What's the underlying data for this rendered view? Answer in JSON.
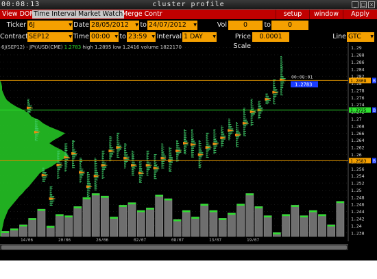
{
  "titlebar": {
    "clock": "00:08:13",
    "title": "cluster profile",
    "btn_min": "_",
    "btn_max": "□",
    "btn_close": "×"
  },
  "menu": {
    "items": [
      "View DOM",
      "Time Interval",
      "Market Watch",
      "Merge Contr"
    ],
    "active": [
      false,
      true,
      true,
      false
    ],
    "right": [
      "setup",
      "window",
      "Apply"
    ]
  },
  "row1": {
    "ticker_label": "Ticker",
    "ticker": "6J",
    "date_label": "Date",
    "date_from": "28/05/2012",
    "to_label": "to",
    "date_to": "24/07/2012",
    "vol_label": "Vol range",
    "vol_from": "0",
    "vol_to_label": "to",
    "vol_to": "0"
  },
  "row2": {
    "contract_label": "Contract",
    "contract": "SEP12",
    "time_label": "Time",
    "time_from": "00:00",
    "to_label": "to",
    "time_to": "23:59",
    "interval_label": "Interval",
    "interval": "1 DAY",
    "scale_label": "Price Scale",
    "scale": "0.0001",
    "line_label": "Line",
    "line": "GTC"
  },
  "chart_header": {
    "symbol": "6J(SEP12) - JPY/USD(CME)",
    "last": "1.2783",
    "high": "high 1.2895",
    "low": "low 1.2416",
    "volume": "volume 1822170"
  },
  "chart_data": {
    "type": "cluster-profile",
    "price_axis": [
      "1.29",
      "1.288",
      "1.286",
      "1.284",
      "1.282",
      "1.28",
      "1.278",
      "1.276",
      "1.274",
      "1.272",
      "1.27",
      "1.268",
      "1.266",
      "1.264",
      "1.262",
      "1.26",
      "1.258",
      "1.256",
      "1.254",
      "1.252",
      "1.25",
      "1.248",
      "1.246",
      "1.244",
      "1.242",
      "1.24",
      "1.238"
    ],
    "ylim": [
      1.237,
      1.2905
    ],
    "date_labels": [
      "14/06",
      "20/06",
      "26/06",
      "02/07",
      "08/07",
      "13/07",
      "19/07"
    ],
    "price_badges": {
      "upper": "1.2808",
      "current": "1.2725",
      "lower": "1.2583"
    },
    "timer": "00:08:01",
    "last_price": "1.2783",
    "side_markers": [
      "B",
      "B",
      "B"
    ],
    "horizontal_lines": [
      1.2808,
      1.2725,
      1.2583
    ],
    "candles": [
      {
        "lo": 1.2716,
        "hi": 1.2755,
        "poc": 1.2731
      },
      {
        "lo": 1.2638,
        "hi": 1.2698,
        "poc": 1.2663
      },
      {
        "lo": 1.2522,
        "hi": 1.2562,
        "poc": 1.2542
      },
      {
        "lo": 1.2455,
        "hi": 1.251,
        "poc": 1.2476
      },
      {
        "lo": 1.253,
        "hi": 1.261,
        "poc": 1.2571
      },
      {
        "lo": 1.255,
        "hi": 1.263,
        "poc": 1.2592
      },
      {
        "lo": 1.256,
        "hi": 1.264,
        "poc": 1.2603
      },
      {
        "lo": 1.252,
        "hi": 1.259,
        "poc": 1.255
      },
      {
        "lo": 1.248,
        "hi": 1.255,
        "poc": 1.251
      },
      {
        "lo": 1.25,
        "hi": 1.259,
        "poc": 1.254
      },
      {
        "lo": 1.253,
        "hi": 1.261,
        "poc": 1.257
      },
      {
        "lo": 1.258,
        "hi": 1.265,
        "poc": 1.261
      },
      {
        "lo": 1.259,
        "hi": 1.266,
        "poc": 1.262
      },
      {
        "lo": 1.256,
        "hi": 1.263,
        "poc": 1.259
      },
      {
        "lo": 1.254,
        "hi": 1.261,
        "poc": 1.257
      },
      {
        "lo": 1.252,
        "hi": 1.258,
        "poc": 1.2548
      },
      {
        "lo": 1.254,
        "hi": 1.261,
        "poc": 1.257
      },
      {
        "lo": 1.253,
        "hi": 1.26,
        "poc": 1.2562
      },
      {
        "lo": 1.256,
        "hi": 1.263,
        "poc": 1.259
      },
      {
        "lo": 1.255,
        "hi": 1.262,
        "poc": 1.2583
      },
      {
        "lo": 1.258,
        "hi": 1.264,
        "poc": 1.261
      },
      {
        "lo": 1.26,
        "hi": 1.267,
        "poc": 1.2632
      },
      {
        "lo": 1.259,
        "hi": 1.267,
        "poc": 1.2628
      },
      {
        "lo": 1.256,
        "hi": 1.264,
        "poc": 1.26
      },
      {
        "lo": 1.259,
        "hi": 1.266,
        "poc": 1.262
      },
      {
        "lo": 1.26,
        "hi": 1.267,
        "poc": 1.263
      },
      {
        "lo": 1.262,
        "hi": 1.268,
        "poc": 1.2647
      },
      {
        "lo": 1.264,
        "hi": 1.27,
        "poc": 1.2668
      },
      {
        "lo": 1.262,
        "hi": 1.269,
        "poc": 1.2655
      },
      {
        "lo": 1.265,
        "hi": 1.273,
        "poc": 1.2688
      },
      {
        "lo": 1.268,
        "hi": 1.2755,
        "poc": 1.272
      },
      {
        "lo": 1.27,
        "hi": 1.275,
        "poc": 1.2725
      },
      {
        "lo": 1.274,
        "hi": 1.277,
        "poc": 1.2755
      },
      {
        "lo": 1.274,
        "hi": 1.281,
        "poc": 1.2775
      },
      {
        "lo": 1.2765,
        "hi": 1.2875,
        "poc": 1.281
      }
    ],
    "volume_relative": [
      0.04,
      0.06,
      0.09,
      0.14,
      0.21,
      0.08,
      0.17,
      0.16,
      0.23,
      0.3,
      0.33,
      0.31,
      0.15,
      0.24,
      0.26,
      0.2,
      0.22,
      0.32,
      0.29,
      0.13,
      0.2,
      0.15,
      0.25,
      0.2,
      0.14,
      0.18,
      0.25,
      0.33,
      0.23,
      0.16,
      0.03,
      0.17,
      0.24,
      0.16,
      0.2,
      0.17,
      0.09,
      0.27
    ],
    "profile_relative": [
      0.0,
      0.0,
      0.0,
      0.02,
      0.03,
      0.03,
      0.05,
      0.07,
      0.1,
      0.16,
      0.24,
      0.34,
      0.42,
      0.46,
      0.57,
      0.63,
      0.72,
      0.84,
      0.95,
      0.88,
      0.79,
      0.72,
      0.8,
      0.9,
      0.97,
      1.0,
      0.9,
      0.82,
      0.75,
      0.65,
      0.58,
      0.54,
      0.5,
      0.46,
      0.42,
      0.37,
      0.33,
      0.28,
      0.24,
      0.2,
      0.16,
      0.12,
      0.1,
      0.08,
      0.06,
      0.05,
      0.04,
      0.03,
      0.02,
      0.02
    ]
  },
  "colors": {
    "accent": "#f5a000",
    "menubar": "#c00000",
    "green": "#2ee02e",
    "line_orange": "#d08a00",
    "badge_blue": "#1a3cff"
  }
}
